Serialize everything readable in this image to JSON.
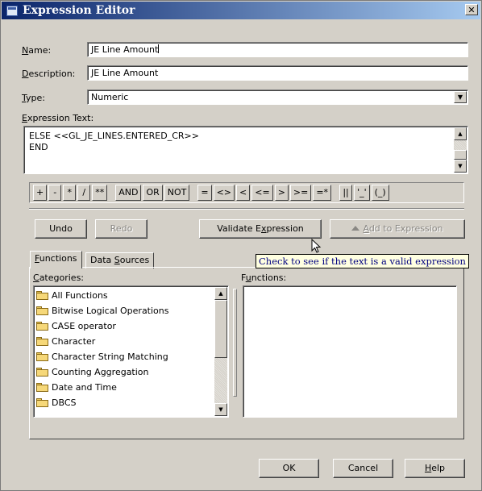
{
  "window": {
    "title": "Expression Editor",
    "close_label": "✕"
  },
  "form": {
    "name_label_key": "N",
    "name_label_rest": "ame:",
    "name_value": "JE Line Amount",
    "description_label_key": "D",
    "description_label_rest": "escription:",
    "description_value": "JE Line Amount",
    "type_label_key": "T",
    "type_label_rest": "ype:",
    "type_value": "Numeric",
    "expression_label_key": "E",
    "expression_label_rest": "xpression Text:",
    "expression_lines": [
      "ELSE <<GL_JE_LINES.ENTERED_CR>>",
      "END"
    ]
  },
  "operators": {
    "group1": [
      "+",
      "-",
      "*",
      "/",
      "**"
    ],
    "group2": [
      "AND",
      "OR",
      "NOT"
    ],
    "group3": [
      "=",
      "<>",
      "<",
      "<=",
      ">",
      ">=",
      "=*"
    ],
    "group4": [
      "||",
      "'_'",
      "(_)"
    ]
  },
  "actions": {
    "undo": "Undo",
    "redo": "Redo",
    "validate_pre": "Validate E",
    "validate_key": "x",
    "validate_post": "pression",
    "add_key": "A",
    "add_rest": "dd to Expression"
  },
  "tabs": {
    "functions_key": "F",
    "functions_rest": "unctions",
    "data_sources_pre": "Data ",
    "data_sources_key": "S",
    "data_sources_post": "ources"
  },
  "tooltip": "Check to see if the text is a valid expression",
  "categories": {
    "label_key": "C",
    "label_rest": "ategories:",
    "items": [
      "All Functions",
      "Bitwise Logical Operations",
      "CASE operator",
      "Character",
      "Character String Matching",
      "Counting Aggregation",
      "Date and Time",
      "DBCS"
    ]
  },
  "functions": {
    "label_pre": "F",
    "label_key": "u",
    "label_rest": "nctions:"
  },
  "footer": {
    "ok": "OK",
    "cancel": "Cancel",
    "help_key": "H",
    "help_rest": "elp"
  }
}
